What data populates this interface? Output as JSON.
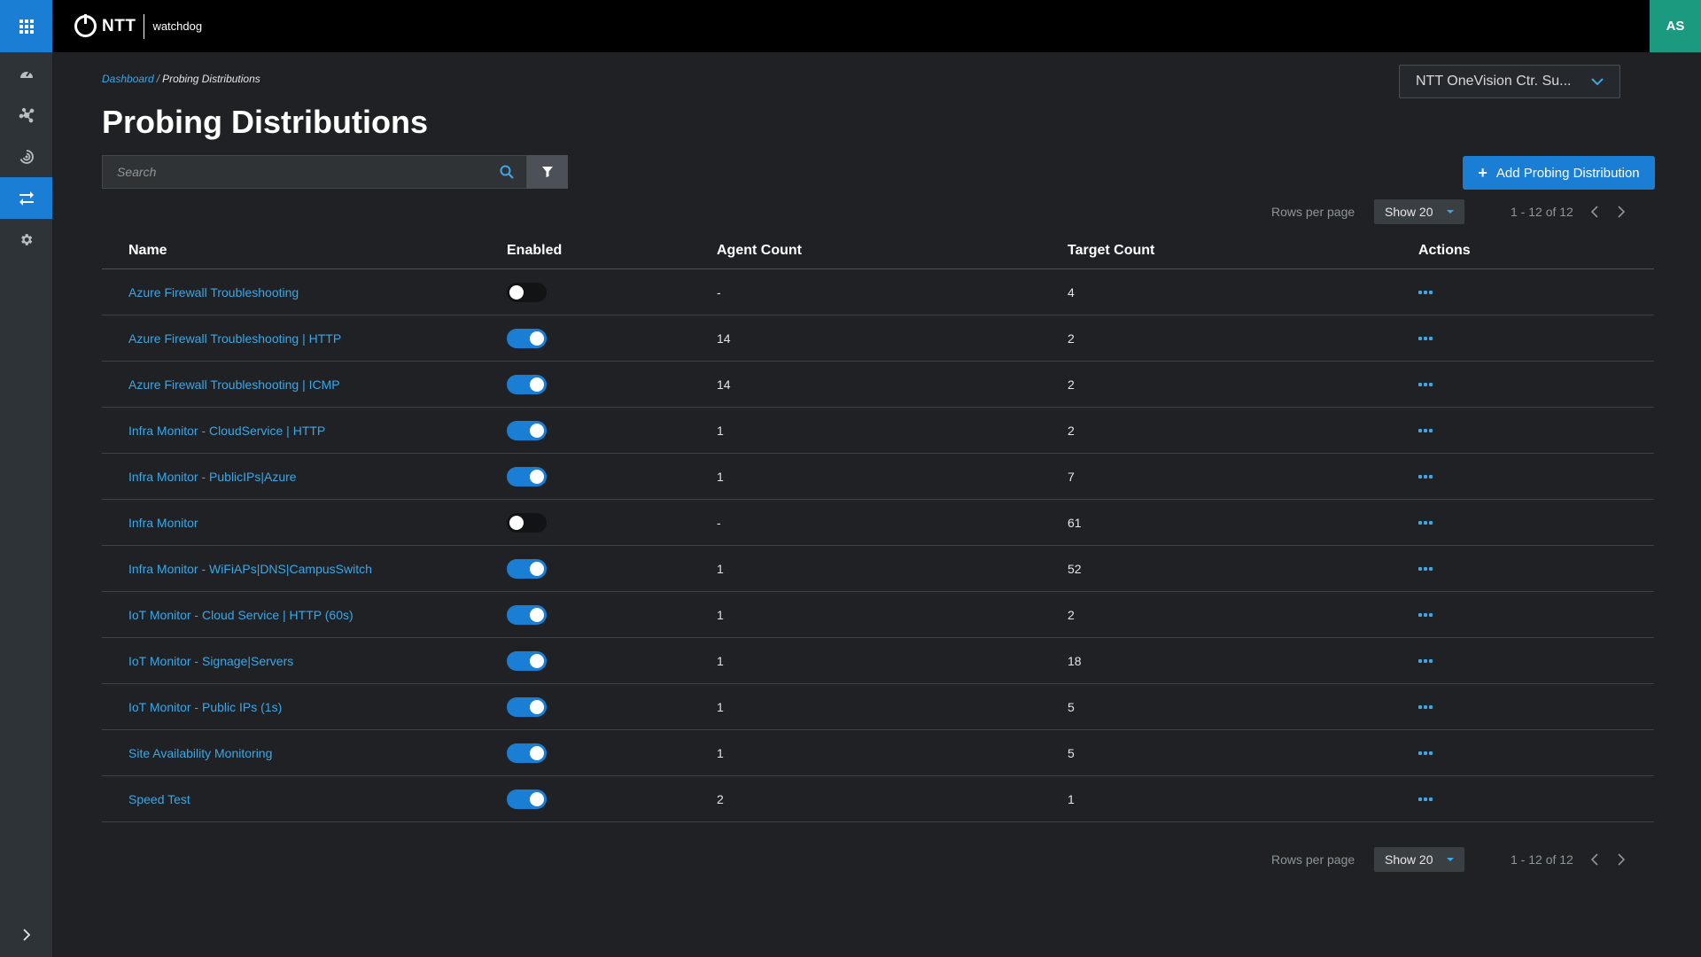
{
  "header": {
    "brand": "NTT",
    "product": "watchdog",
    "user_initials": "AS"
  },
  "sidebar": {
    "items": [
      {
        "icon": "dashboard-gauge-icon"
      },
      {
        "icon": "network-nodes-icon"
      },
      {
        "icon": "radar-icon"
      },
      {
        "icon": "transfer-arrows-icon",
        "active": true
      },
      {
        "icon": "gear-icon"
      }
    ],
    "expand_icon": "chevron-right-icon"
  },
  "breadcrumb": {
    "parent": "Dashboard",
    "separator": "/",
    "current": "Probing Distributions"
  },
  "tenant": {
    "selected": "NTT OneVision Ctr. Su..."
  },
  "page": {
    "title": "Probing Distributions"
  },
  "search": {
    "placeholder": "Search",
    "value": ""
  },
  "actions": {
    "add_label": "Add Probing Distribution"
  },
  "pagination": {
    "rows_label": "Rows per page",
    "show_label": "Show 20",
    "range": "1 - 12 of 12"
  },
  "table": {
    "columns": [
      "Name",
      "Enabled",
      "Agent Count",
      "Target Count",
      "Actions"
    ],
    "rows": [
      {
        "name": "Azure Firewall Troubleshooting",
        "enabled": false,
        "agent_count": "-",
        "target_count": "4"
      },
      {
        "name": "Azure Firewall Troubleshooting | HTTP",
        "enabled": true,
        "agent_count": "14",
        "target_count": "2"
      },
      {
        "name": "Azure Firewall Troubleshooting | ICMP",
        "enabled": true,
        "agent_count": "14",
        "target_count": "2"
      },
      {
        "name": "Infra Monitor - CloudService | HTTP",
        "enabled": true,
        "agent_count": "1",
        "target_count": "2"
      },
      {
        "name": "Infra Monitor - PublicIPs|Azure",
        "enabled": true,
        "agent_count": "1",
        "target_count": "7"
      },
      {
        "name": "Infra Monitor",
        "enabled": false,
        "agent_count": "-",
        "target_count": "61"
      },
      {
        "name": "Infra Monitor - WiFiAPs|DNS|CampusSwitch",
        "enabled": true,
        "agent_count": "1",
        "target_count": "52"
      },
      {
        "name": "IoT Monitor - Cloud Service | HTTP (60s)",
        "enabled": true,
        "agent_count": "1",
        "target_count": "2"
      },
      {
        "name": "IoT Monitor - Signage|Servers",
        "enabled": true,
        "agent_count": "1",
        "target_count": "18"
      },
      {
        "name": "IoT Monitor - Public IPs (1s)",
        "enabled": true,
        "agent_count": "1",
        "target_count": "5"
      },
      {
        "name": "Site Availability Monitoring",
        "enabled": true,
        "agent_count": "1",
        "target_count": "5"
      },
      {
        "name": "Speed Test",
        "enabled": true,
        "agent_count": "2",
        "target_count": "1"
      }
    ]
  },
  "colors": {
    "accent": "#1a7fd4",
    "link": "#3ba7e6",
    "avatar": "#1c9a80",
    "background": "#1f2124"
  }
}
